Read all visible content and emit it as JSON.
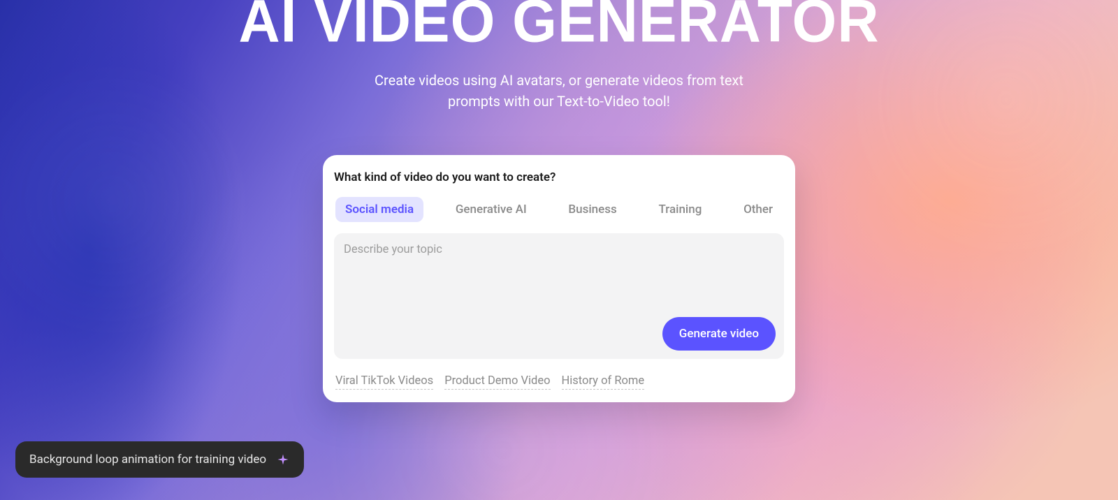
{
  "hero": {
    "title": "AI VIDEO GENERATOR",
    "subtitle": "Create videos using AI avatars, or generate videos from text prompts with our Text-to-Video tool!"
  },
  "card": {
    "prompt": "What kind of video do you want to create?",
    "tabs": [
      "Social media",
      "Generative AI",
      "Business",
      "Training",
      "Other"
    ],
    "active_tab_index": 0,
    "textarea_placeholder": "Describe your topic",
    "textarea_value": "",
    "generate_button": "Generate video",
    "suggestions": [
      "Viral TikTok Videos",
      "Product Demo Video",
      "History of Rome"
    ]
  },
  "toast": {
    "text": "Background loop animation for training video",
    "icon": "spark-icon"
  },
  "colors": {
    "accent": "#5b53ff",
    "tab_active_bg": "#e3e3ff"
  }
}
